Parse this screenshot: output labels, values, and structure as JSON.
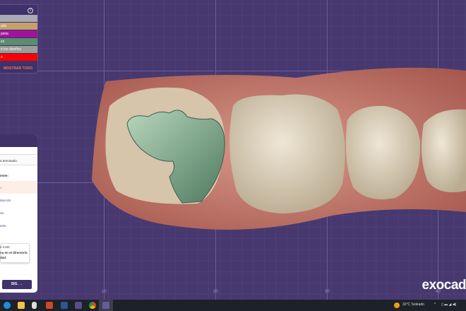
{
  "layers_panel": {
    "help_icon": "question-circle-icon",
    "layers": [
      {
        "label": "",
        "color": "#a9a9b3"
      },
      {
        "label": "ado",
        "color": "#c4a06a"
      },
      {
        "label": "pieta",
        "color": "#a0149c"
      },
      {
        "label": "es",
        "color": "#5b8c6e"
      },
      {
        "label": "e los diseños",
        "color": "#9a9d98"
      },
      {
        "label": "o",
        "color": "#ff0000"
      }
    ],
    "show_all": "MOSTRAR TODO"
  },
  "wizard": {
    "message": "a terminado.",
    "next_label": "iente:",
    "steps": [
      "o",
      "ducción",
      "rto",
      "seto"
    ],
    "cad_title": "e CAD:",
    "cad_text": "na en el directorio",
    "cad_text2": "dad.",
    "next_button": "SIG. →"
  },
  "grid_ticks": [
    "10",
    "20",
    "30",
    "40"
  ],
  "logo": "exocad",
  "taskbar": {
    "apps": [
      "edge",
      "file-explorer",
      "security",
      "powerpoint",
      "word",
      "exocad",
      "chrome",
      "exocad-active"
    ],
    "weather": "32°C  Soleado"
  },
  "colors": {
    "background": "#47396f",
    "accent": "#3f3169"
  }
}
